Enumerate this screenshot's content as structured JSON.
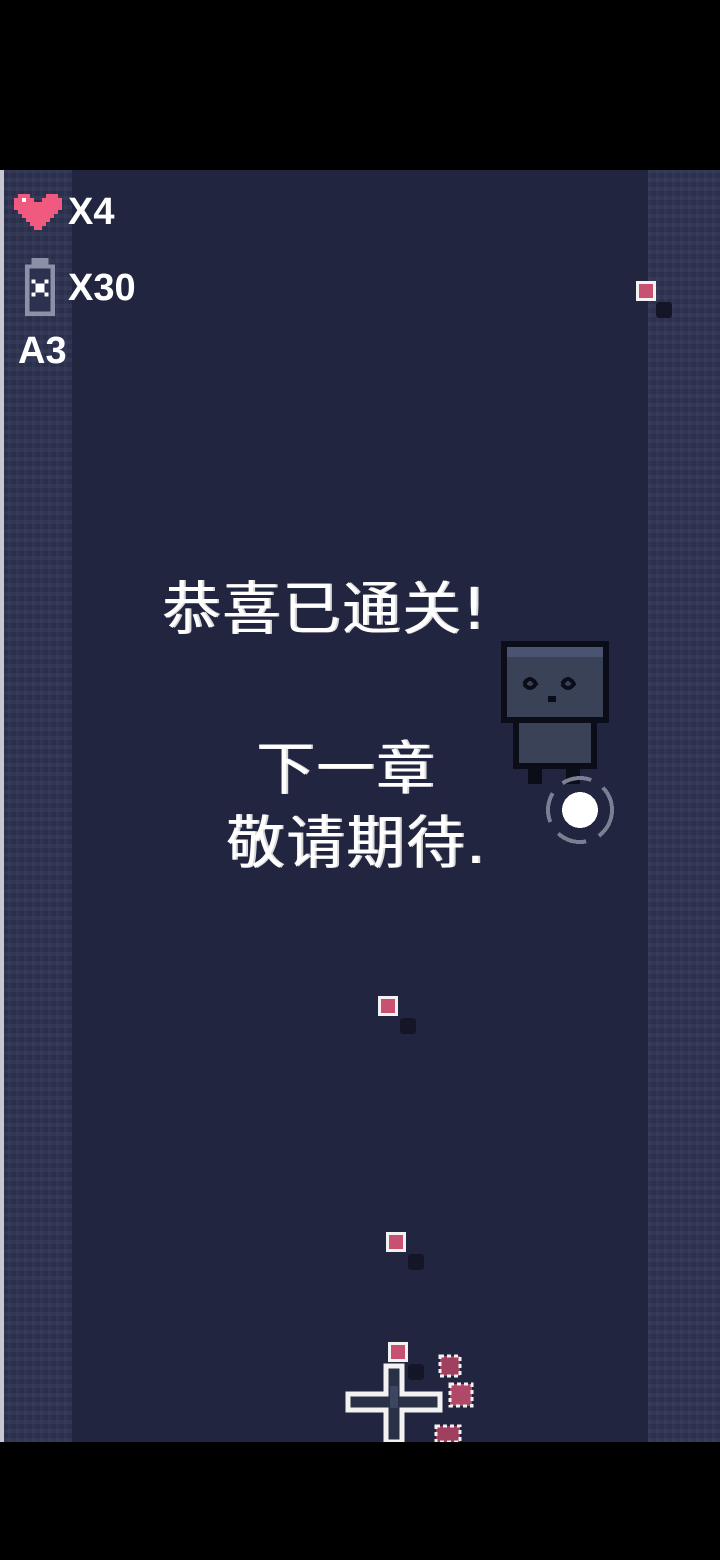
{
  "hud": {
    "lives_label": "X4",
    "ammo_label": "X30",
    "stage_label": "A3",
    "lives_icon": "heart-icon",
    "ammo_icon": "bomb-icon"
  },
  "message": {
    "line1": "恭喜已通关!",
    "line2": "下一章",
    "line3": "敬请期待."
  },
  "colors": {
    "background": "#222540",
    "heart": "#f05a7e",
    "bullet": "#c85070"
  }
}
